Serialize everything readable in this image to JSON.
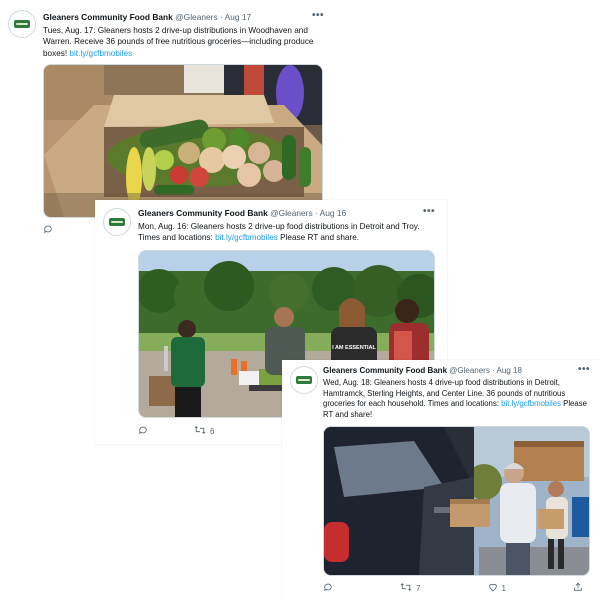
{
  "tweets": [
    {
      "author": "Gleaners Community Food Bank",
      "handle": "@Gleaners",
      "date": "Aug 17",
      "text": "Tues, Aug. 17: Gleaners hosts 2 drive-up distributions in Woodhaven and Warren. Receive 36 pounds of free nutritious groceries—including produce boxes! ",
      "link": "bit.ly/gcfbmobiles",
      "text_after": "",
      "retweets": "",
      "likes": ""
    },
    {
      "author": "Gleaners Community Food Bank",
      "handle": "@Gleaners",
      "date": "Aug 16",
      "text": "Mon,  Aug. 16: Gleaners hosts 2 drive-up food distributions in Detroit and Troy. Times and locations: ",
      "link": "bit.ly/gcfbmobiles",
      "text_after": " Please RT and share.",
      "retweets": "6",
      "likes": "",
      "photo_text": "I AM ESSENTIAL"
    },
    {
      "author": "Gleaners Community Food Bank",
      "handle": "@Gleaners",
      "date": "Aug 18",
      "text": "Wed, Aug. 18: Gleaners hosts 4 drive-up food distributions in Detroit, Hamtramck, Sterling Heights, and Center Line. 36 pounds of nutritious groceries for each household. Times and locations: ",
      "link": "bit.ly/gcfbmobiles",
      "text_after": " Please RT and share!",
      "retweets": "7",
      "likes": "1"
    }
  ],
  "sep": "·",
  "more_label": "•••",
  "colors": {
    "link": "#1d9bf0",
    "meta": "#536471",
    "brand_green": "#2d7a3a"
  },
  "icons": [
    "reply-icon",
    "retweet-icon",
    "like-icon",
    "share-icon",
    "more-icon",
    "avatar-logo"
  ]
}
